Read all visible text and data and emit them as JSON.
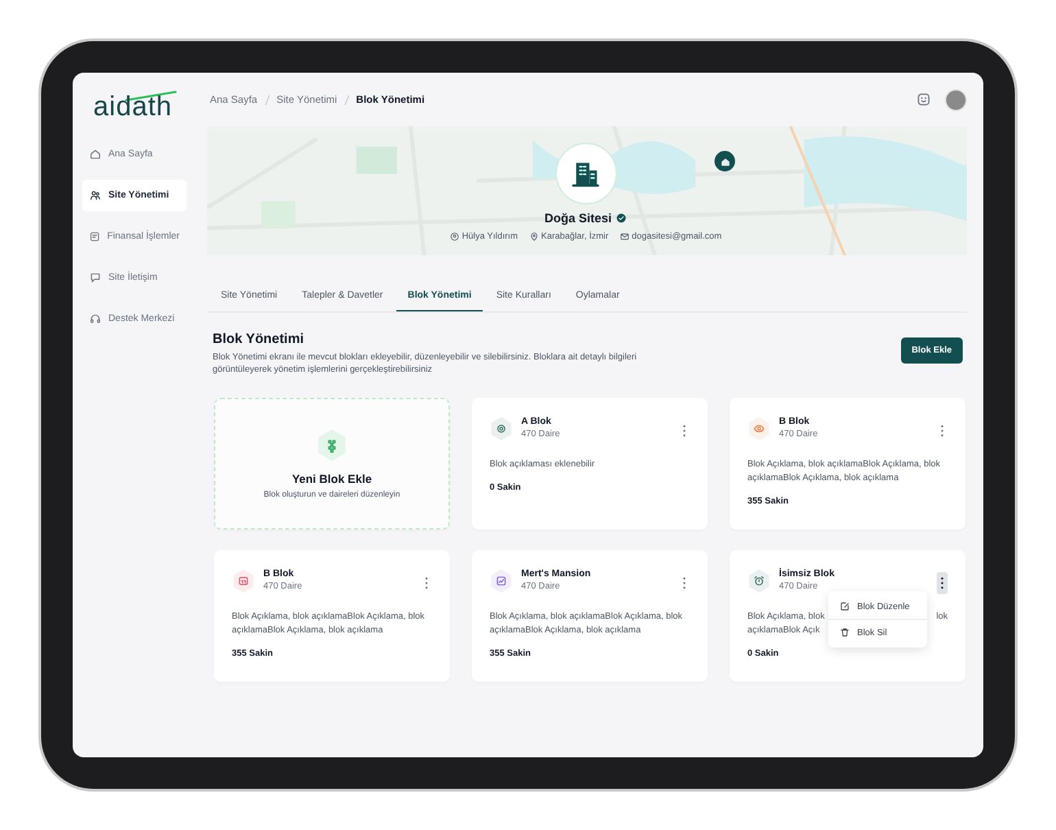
{
  "logo": "aidath",
  "sidebar": {
    "items": [
      {
        "label": "Ana Sayfa",
        "selected": false
      },
      {
        "label": "Site Yönetimi",
        "selected": true
      },
      {
        "label": "Finansal İşlemler",
        "selected": false
      },
      {
        "label": "Site İletişim",
        "selected": false
      },
      {
        "label": "Destek Merkezi",
        "selected": false
      }
    ]
  },
  "breadcrumb": [
    {
      "label": "Ana Sayfa",
      "selected": false
    },
    {
      "label": "Site Yönetimi",
      "selected": false
    },
    {
      "label": "Blok Yönetimi",
      "selected": true
    }
  ],
  "site": {
    "name": "Doğa Sitesi",
    "verified": true,
    "manager": "Hülya Yıldırım",
    "location": "Karabağlar, İzmir",
    "email": "dogasitesi@gmail.com"
  },
  "tabs": [
    {
      "label": "Site Yönetimi",
      "selected": false
    },
    {
      "label": "Talepler & Davetler",
      "selected": false
    },
    {
      "label": "Blok Yönetimi",
      "selected": true
    },
    {
      "label": "Site Kuralları",
      "selected": false
    },
    {
      "label": "Oylamalar",
      "selected": false
    }
  ],
  "section": {
    "title": "Blok Yönetimi",
    "description": "Blok Yönetimi ekranı ile mevcut blokları ekleyebilir, düzenleyebilir ve silebilirsiniz. Bloklara ait detaylı bilgileri görüntüleyerek yönetim işlemlerini gerçekleştirebilirsiniz",
    "button": "Blok Ekle"
  },
  "new_block": {
    "title": "Yeni Blok Ekle",
    "subtitle": "Blok oluşturun ve daireleri düzenleyin"
  },
  "blocks": [
    {
      "name": "A Blok",
      "units": "470 Daire",
      "description": "Blok açıklaması eklenebilir",
      "residents": "0 Sakin",
      "color": "#2f6b5e",
      "menu_open": false
    },
    {
      "name": "B Blok",
      "units": "470 Daire",
      "description": "Blok Açıklama, blok açıklamaBlok Açıklama, blok açıklamaBlok Açıklama, blok açıklama",
      "residents": "355 Sakin",
      "color": "#f07a3a",
      "menu_open": false
    },
    {
      "name": "B Blok",
      "units": "470 Daire",
      "description": "Blok Açıklama, blok açıklamaBlok Açıklama, blok açıklamaBlok Açıklama, blok açıklama",
      "residents": "355 Sakin",
      "color": "#e8455a",
      "menu_open": false
    },
    {
      "name": "Mert's Mansion",
      "units": "470 Daire",
      "description": "Blok Açıklama, blok açıklamaBlok Açıklama, blok açıklamaBlok Açıklama, blok açıklama",
      "residents": "355 Sakin",
      "color": "#7c5ce0",
      "menu_open": false
    },
    {
      "name": "İsimsiz Blok",
      "units": "470 Daire",
      "description": [
        [
          "Blok Açıklama, blok",
          "lok"
        ],
        [
          "açıklamaBlok Açık"
        ]
      ],
      "residents": "0 Sakin",
      "color": "#2f6b5e",
      "menu_open": true
    }
  ],
  "block_menu": [
    {
      "label": "Blok Düzenle",
      "kind": "edit"
    },
    {
      "label": "Blok Sil",
      "kind": "delete"
    }
  ]
}
